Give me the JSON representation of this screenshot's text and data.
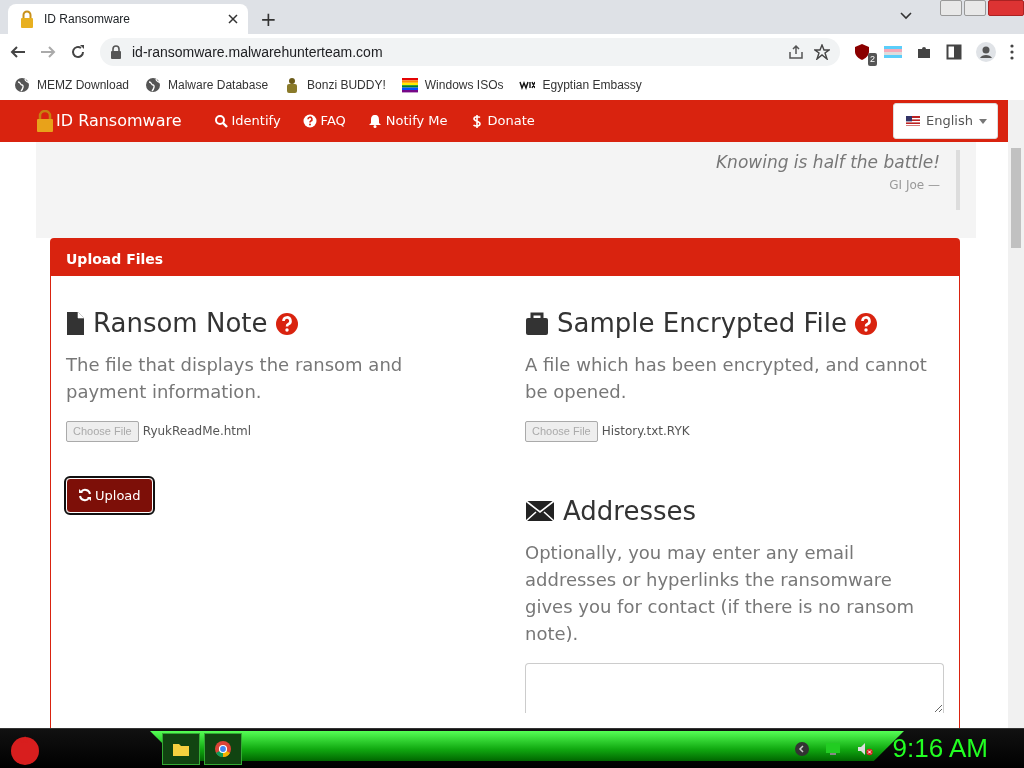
{
  "browser": {
    "tabs": [
      {
        "title": "ID Ransomware",
        "selected": true
      }
    ],
    "new_tab": "+",
    "address": "id-ransomware.malwarehunterteam.com",
    "extension_badge": "2",
    "bookmarks": [
      {
        "label": "MEMZ Download",
        "kind": "globe"
      },
      {
        "label": "Malware Database",
        "kind": "globe"
      },
      {
        "label": "Bonzi BUDDY!",
        "kind": "figure"
      },
      {
        "label": "Windows ISOs",
        "kind": "rainbow"
      },
      {
        "label": "Egyptian Embassy",
        "kind": "wix"
      }
    ]
  },
  "navbar": {
    "brand": "ID Ransomware",
    "items": [
      {
        "label": "Identify",
        "kind": "search"
      },
      {
        "label": "FAQ",
        "kind": "question"
      },
      {
        "label": "Notify Me",
        "kind": "bell"
      },
      {
        "label": "Donate",
        "kind": "dollar"
      }
    ],
    "language": "English"
  },
  "quote": {
    "text": "Knowing is half the battle!",
    "author": "GI Joe —"
  },
  "panel": {
    "title": "Upload Files",
    "ransom_note": {
      "heading": "Ransom Note",
      "description": "The file that displays the ransom and payment information.",
      "file_button": "Choose File",
      "file_name": "RyukReadMe.html",
      "upload": "Upload"
    },
    "sample": {
      "heading": "Sample Encrypted File",
      "description": "A file which has been encrypted, and cannot be opened.",
      "file_button": "Choose File",
      "file_name": "History.txt.RYK"
    },
    "addresses": {
      "heading": "Addresses",
      "description": "Optionally, you may enter any email addresses or hyperlinks the ransomware gives you for contact (if there is no ransom note)."
    }
  },
  "taskbar": {
    "clock": "9:16 AM"
  }
}
